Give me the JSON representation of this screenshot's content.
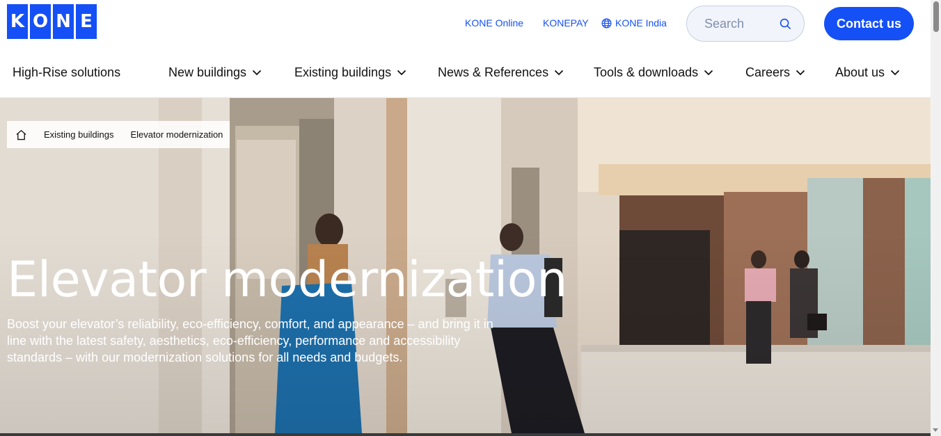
{
  "logo": {
    "letters": [
      "K",
      "O",
      "N",
      "E"
    ],
    "color": "#1450f5"
  },
  "utility": {
    "links": [
      {
        "label": "KONE Online"
      },
      {
        "label": "KONEPAY"
      },
      {
        "label": "KONE India",
        "icon": "globe-icon"
      }
    ],
    "search": {
      "placeholder": "Search",
      "icon": "search-icon"
    },
    "contact_label": "Contact us"
  },
  "nav": {
    "items": [
      {
        "label": "High-Rise solutions",
        "dropdown": false
      },
      {
        "label": "New buildings",
        "dropdown": true
      },
      {
        "label": "Existing buildings",
        "dropdown": true
      },
      {
        "label": "News & References",
        "dropdown": true
      },
      {
        "label": "Tools & downloads",
        "dropdown": true
      },
      {
        "label": "Careers",
        "dropdown": true
      },
      {
        "label": "About us",
        "dropdown": true
      }
    ]
  },
  "breadcrumb": {
    "home_icon": "home-icon",
    "items": [
      "Existing buildings",
      "Elevator modernization"
    ]
  },
  "hero": {
    "title": "Elevator modernization",
    "text": "Boost your elevator’s reliability, eco-efficiency, comfort, and appearance – and bring it in line with the latest safety, aesthetics, eco-efficiency, performance and accessibility standards – with our modernization solutions for all needs and budgets."
  },
  "colors": {
    "accent": "#1450f5",
    "text": "#111111"
  }
}
